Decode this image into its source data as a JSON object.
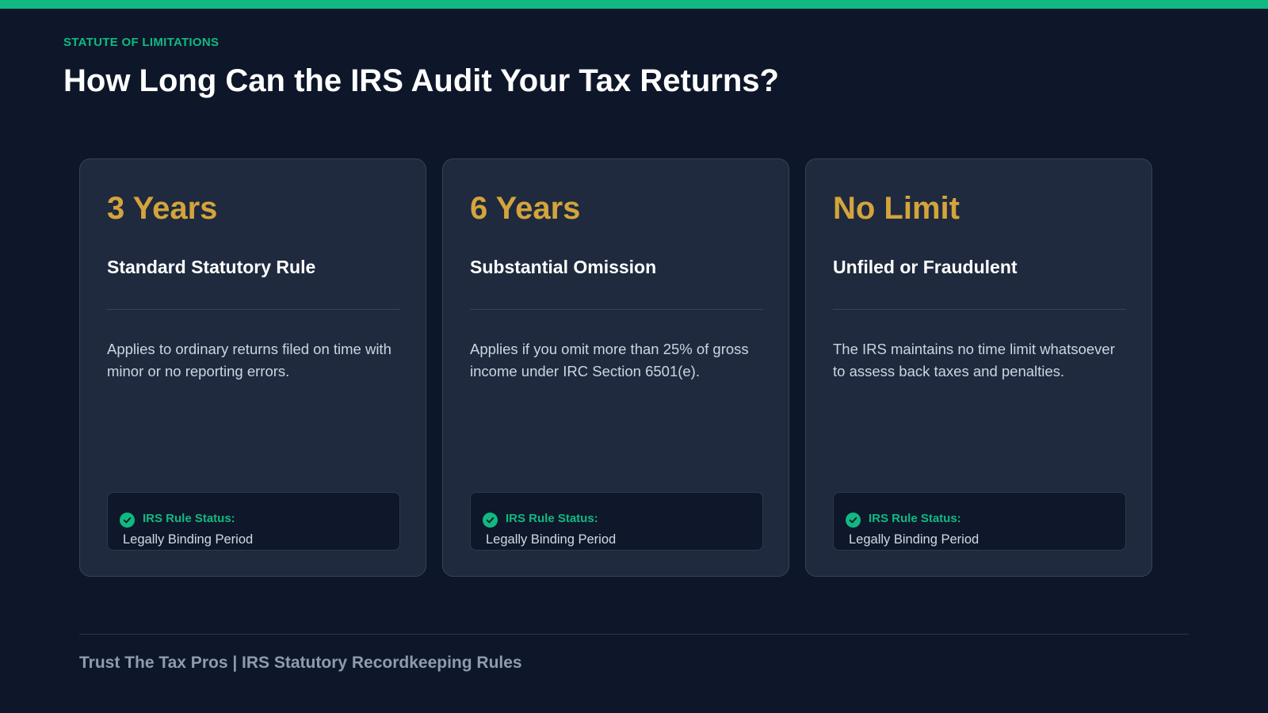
{
  "header": {
    "eyebrow": "STATUTE OF LIMITATIONS",
    "title": "How Long Can the IRS Audit Your Tax Returns?"
  },
  "cards": [
    {
      "value": "3 Years",
      "heading": "Standard Statutory Rule",
      "description": "Applies to ordinary returns filed on time with minor or no reporting errors.",
      "status_label": "IRS Rule Status:",
      "status_value": "Legally Binding Period",
      "status_icon": "check-circle-icon"
    },
    {
      "value": "6 Years",
      "heading": "Substantial Omission",
      "description": "Applies if you omit more than 25% of gross income under IRC Section 6501(e).",
      "status_label": "IRS Rule Status:",
      "status_value": "Legally Binding Period",
      "status_icon": "check-circle-icon"
    },
    {
      "value": "No Limit",
      "heading": "Unfiled or Fraudulent",
      "description": "The IRS maintains no time limit whatsoever to assess back taxes and penalties.",
      "status_label": "IRS Rule Status:",
      "status_value": "Legally Binding Period",
      "status_icon": "check-circle-icon"
    }
  ],
  "footer": {
    "text": "Trust The Tax Pros | IRS Statutory Recordkeeping Rules"
  },
  "colors": {
    "background": "#0e1729",
    "accent": "#10b981",
    "highlight": "#d4a43c",
    "card": "#1f2a3e"
  }
}
